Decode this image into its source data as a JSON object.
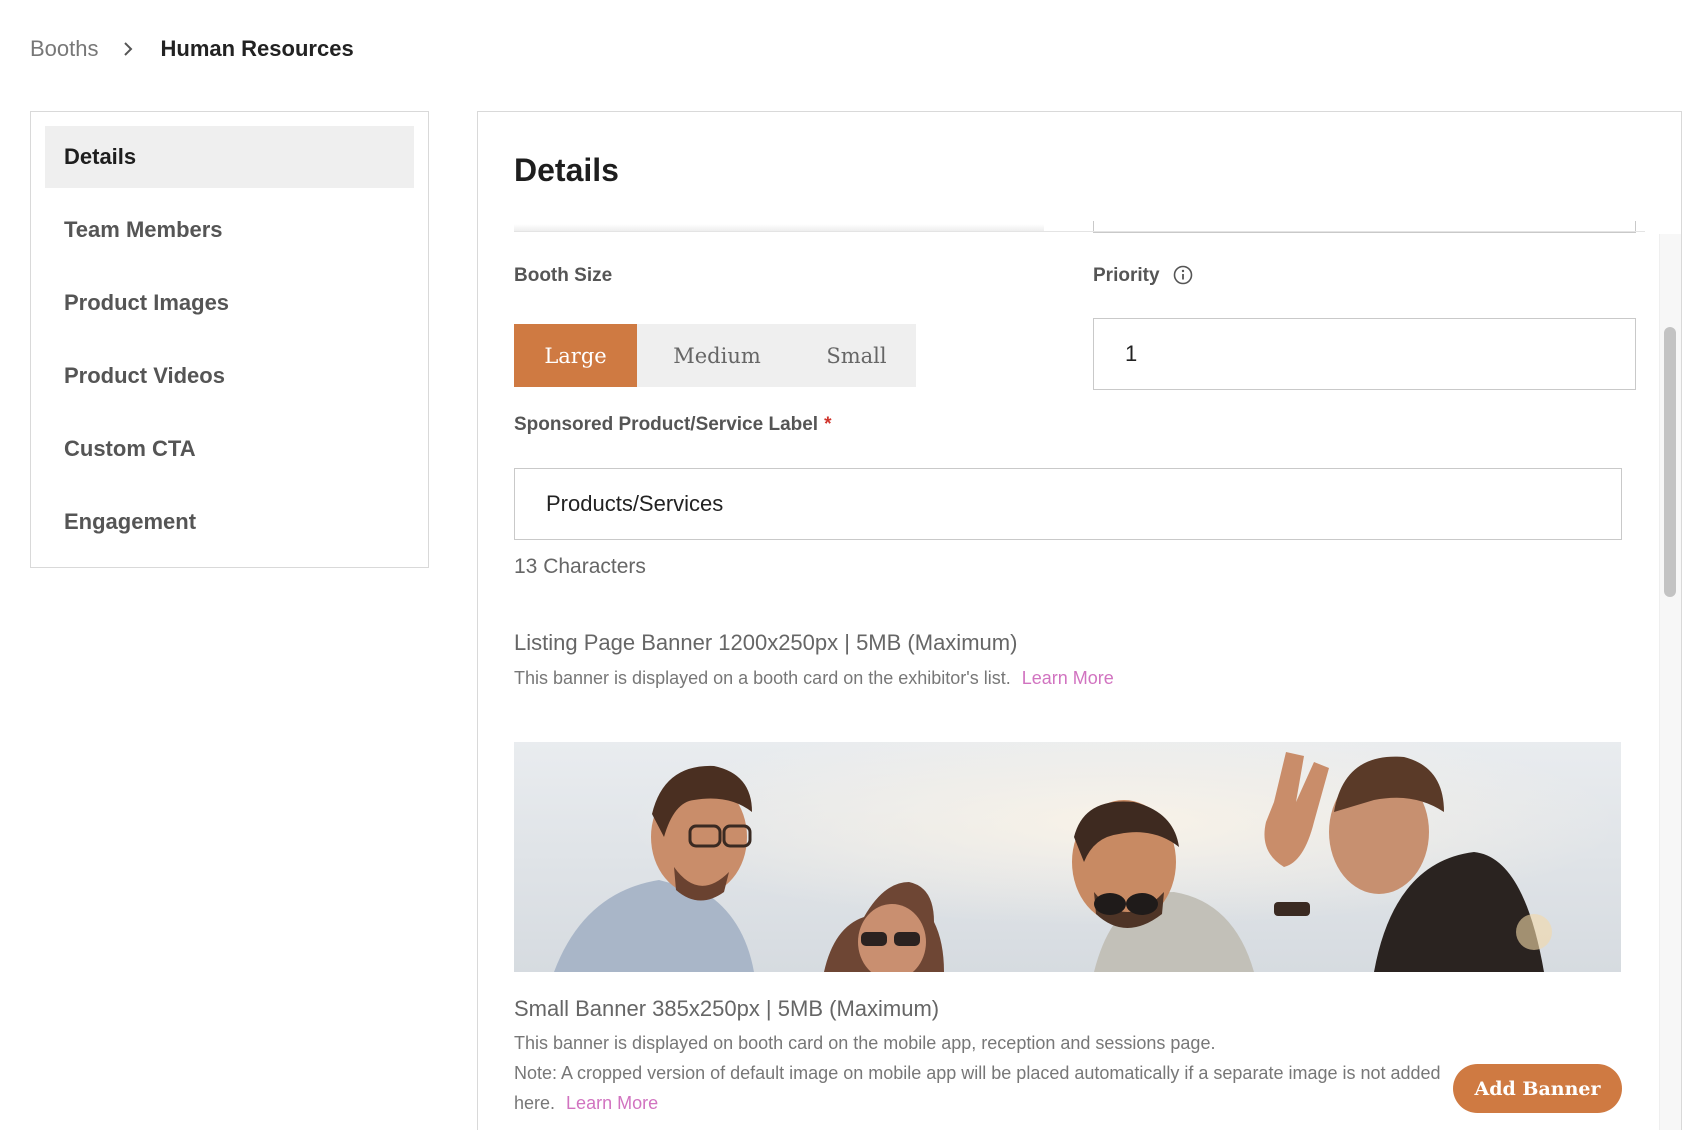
{
  "breadcrumb": {
    "parent": "Booths",
    "current": "Human Resources"
  },
  "sidebar": {
    "items": [
      {
        "label": "Details",
        "active": true
      },
      {
        "label": "Team Members"
      },
      {
        "label": "Product Images"
      },
      {
        "label": "Product Videos"
      },
      {
        "label": "Custom CTA"
      },
      {
        "label": "Engagement"
      }
    ]
  },
  "main": {
    "title": "Details",
    "booth_size": {
      "label": "Booth Size",
      "options": [
        "Large",
        "Medium",
        "Small"
      ],
      "selected": "Large"
    },
    "priority": {
      "label": "Priority",
      "value": "1",
      "icon": "info-icon"
    },
    "sponsored_label": {
      "label": "Sponsored Product/Service Label",
      "required_mark": "*",
      "value": "Products/Services",
      "char_count": "13 Characters"
    },
    "listing_banner": {
      "title": "Listing Page Banner 1200x250px | 5MB (Maximum)",
      "description": "This banner is displayed on a booth card on the exhibitor's list.",
      "link": "Learn More"
    },
    "small_banner": {
      "title": "Small Banner 385x250px | 5MB (Maximum)",
      "description": "This banner is displayed on booth card on the mobile app, reception and sessions page.",
      "note": "Note: A cropped version of default image on mobile app will be placed automatically if a separate image is not added here.",
      "link": "Learn More",
      "button": "Add Banner"
    }
  },
  "colors": {
    "accent": "#cf7a42",
    "link": "#d173c0",
    "required": "#d0342c"
  }
}
